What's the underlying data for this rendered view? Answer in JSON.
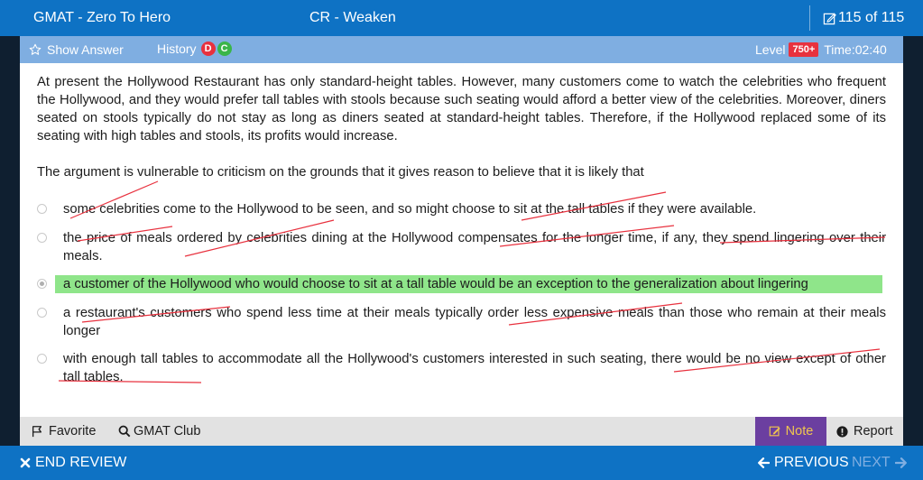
{
  "header": {
    "app_title": "GMAT - Zero To Hero",
    "section": "CR - Weaken",
    "question_count": "115 of 115",
    "count_icon": "edit-square-icon"
  },
  "toolbar": {
    "show_answer": "Show Answer",
    "history_label": "History",
    "history_badges": [
      "D",
      "C"
    ],
    "history_colors": [
      "#e8313e",
      "#3ab54a"
    ],
    "level_label": "Level",
    "level_badge": "750+",
    "timer": "Time:02:40"
  },
  "question": {
    "stimulus": "At present the Hollywood Restaurant has only standard-height tables. However, many customers come to watch the celebrities who frequent the Hollywood, and they would prefer tall tables with stools because such seating would afford a better view of the celebrities. Moreover, diners seated on stools typically do not stay as long as diners seated at standard-height tables. Therefore, if the Hollywood replaced some of its seating with high tables and stools, its profits would increase.",
    "prompt": "The argument is vulnerable to criticism on the grounds that it gives reason to believe that it is likely that",
    "options": [
      "some celebrities come to the Hollywood to be seen, and so might choose to sit at the tall tables if they were available.",
      "the price of meals ordered by celebrities dining at the Hollywood compensates for the longer time, if any, they spend lingering over their meals.",
      "a customer of the Hollywood who would choose to sit at a tall table would be an exception to the generalization about lingering",
      "a restaurant's customers who spend less time at their meals typically order less expensive meals than those who remain at their meals longer",
      "with enough tall tables to accommodate all the Hollywood's customers interested in such seating, there would be no view except of other tall tables."
    ],
    "selected_index": 2,
    "highlight_color": "#8fe58a",
    "markup_color": "#e8313e"
  },
  "footer": {
    "favorite": "Favorite",
    "club": "GMAT Club",
    "note": "Note",
    "report": "Report"
  },
  "nav": {
    "end_review": "END REVIEW",
    "previous": "PREVIOUS",
    "next": "NEXT"
  },
  "colors": {
    "primary_blue": "#0e72c4",
    "subbar_blue": "#7faee1",
    "note_purple": "#6b3fa0"
  }
}
